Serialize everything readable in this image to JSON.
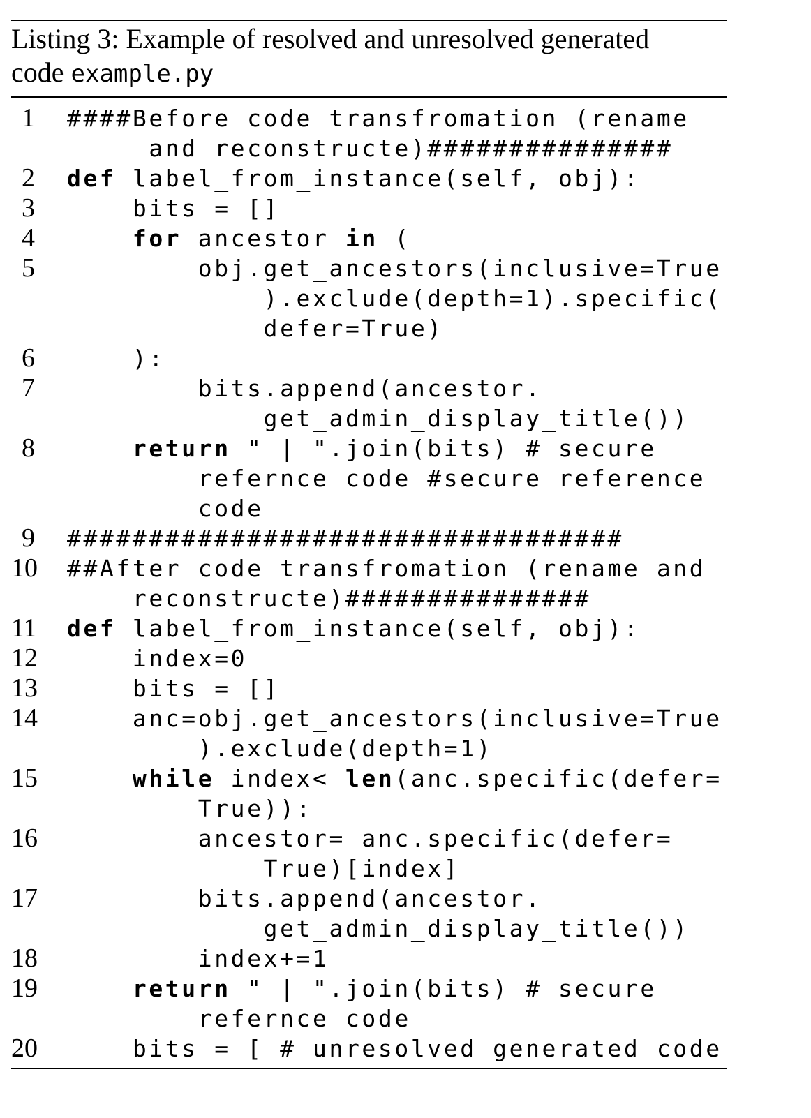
{
  "caption": {
    "label": "Listing 3: Example of resolved and unresolved generated",
    "line2_prefix": "code ",
    "filename": "example.py"
  },
  "code_lines": [
    {
      "num": "1",
      "rows": [
        [
          "####Before code transfromation (rename"
        ],
        [
          "     and reconstructe)###############"
        ]
      ]
    },
    {
      "num": "2",
      "rows": [
        [
          {
            "kw": "def"
          },
          " label_from_instance(self, obj):"
        ]
      ]
    },
    {
      "num": "3",
      "rows": [
        [
          "    bits = []"
        ]
      ]
    },
    {
      "num": "4",
      "rows": [
        [
          "    ",
          {
            "kw": "for"
          },
          " ancestor ",
          {
            "kw": "in"
          },
          " ("
        ]
      ]
    },
    {
      "num": "5",
      "rows": [
        [
          "        obj.get_ancestors(inclusive=True"
        ],
        [
          "            ).exclude(depth=1).specific("
        ],
        [
          "            defer=True)"
        ]
      ]
    },
    {
      "num": "6",
      "rows": [
        [
          "    ):"
        ]
      ]
    },
    {
      "num": "7",
      "rows": [
        [
          "        bits.append(ancestor."
        ],
        [
          "            get_admin_display_title())"
        ]
      ]
    },
    {
      "num": "8",
      "rows": [
        [
          "    ",
          {
            "kw": "return"
          },
          " \" | \".join(bits) # secure"
        ],
        [
          "        refernce code #secure reference"
        ],
        [
          "        code"
        ]
      ]
    },
    {
      "num": "9",
      "rows": [
        [
          "##################################"
        ]
      ]
    },
    {
      "num": "10",
      "rows": [
        [
          "##After code transfromation (rename and"
        ],
        [
          "    reconstructe)###############"
        ]
      ]
    },
    {
      "num": "11",
      "rows": [
        [
          {
            "kw": "def"
          },
          " label_from_instance(self, obj):"
        ]
      ]
    },
    {
      "num": "12",
      "rows": [
        [
          "    index=0"
        ]
      ]
    },
    {
      "num": "13",
      "rows": [
        [
          "    bits = []"
        ]
      ]
    },
    {
      "num": "14",
      "rows": [
        [
          "    anc=obj.get_ancestors(inclusive=True"
        ],
        [
          "        ).exclude(depth=1)"
        ]
      ]
    },
    {
      "num": "15",
      "rows": [
        [
          "    ",
          {
            "kw": "while"
          },
          " index< ",
          {
            "kw": "len"
          },
          "(anc.specific(defer="
        ],
        [
          "        True)):"
        ]
      ]
    },
    {
      "num": "16",
      "rows": [
        [
          "        ancestor= anc.specific(defer="
        ],
        [
          "            True)[index]"
        ]
      ]
    },
    {
      "num": "17",
      "rows": [
        [
          "        bits.append(ancestor."
        ],
        [
          "            get_admin_display_title())"
        ]
      ]
    },
    {
      "num": "18",
      "rows": [
        [
          "        index+=1"
        ]
      ]
    },
    {
      "num": "19",
      "rows": [
        [
          "    ",
          {
            "kw": "return"
          },
          " \" | \".join(bits) # secure"
        ],
        [
          "        refernce code"
        ]
      ]
    },
    {
      "num": "20",
      "rows": [
        [
          "    bits = [ # unresolved generated code"
        ]
      ]
    }
  ]
}
